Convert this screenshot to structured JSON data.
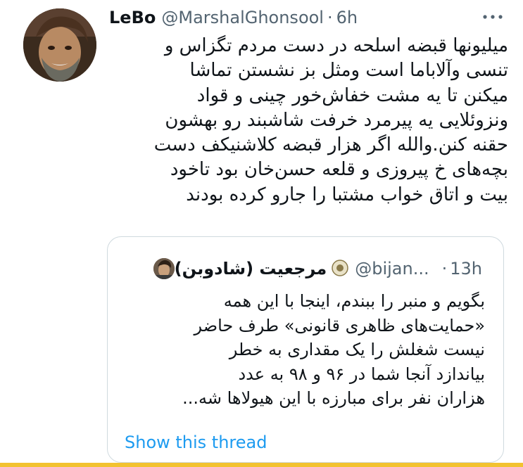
{
  "tweet": {
    "display_name": "LeBo",
    "handle": "@MarshalGhonsool",
    "separator": "·",
    "time": "6h",
    "more_icon": "more-horizontal-icon",
    "text": "میلیونها قبضه اسلحه در دست مردم تگزاس و\nتنسی وآلاباما است ومثل بز نشستن تماشا\nمیکنن تا یه مشت خفاش‌خور چینی و قواد\nونزوئلایی یه پیرمرد خرفت شاشبند رو بهشون\nحقنه کنن.والله اگر هزار قبضه کلاشنیکف دست\nبچه‌های خ پیروزی و قلعه حسن‌خان بود تاخود\nبیت و اتاق خواب مشتبا را جارو کرده بودند"
  },
  "quoted": {
    "name": "مرجعیت (شادوبن)",
    "verified_icon": "badge-icon",
    "handle": "@bijan...",
    "separator": "·",
    "time": "13h",
    "text": "بگویم و منبر را ببندم، اینجا با این همه\n«حمایت‌های ظاهری قانونی» طرف حاضر\nنیست شغلش را یک مقداری به خطر\nبیاندازد آنجا شما در ۹۶ و ۹۸ به عدد\nهزاران نفر برای مبارزه با این هیولاها شه...",
    "show_thread": "Show this thread"
  },
  "colors": {
    "link": "#1d9bf0",
    "secondary": "#536471",
    "border": "#cfd9de",
    "bottom_bar": "#f2c230"
  }
}
